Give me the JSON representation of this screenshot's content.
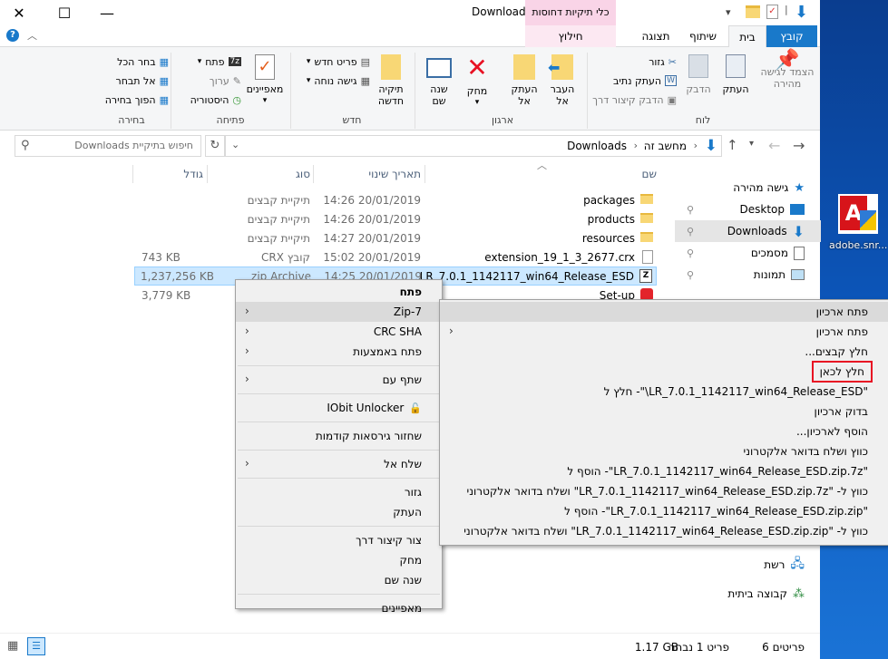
{
  "window": {
    "title": "Downloads",
    "context_tab_group": "כלי תיקיות דחוסות",
    "minimize": "—",
    "maximize": "☐",
    "close": "✕"
  },
  "ribbon_tabs": [
    "קובץ",
    "בית",
    "שיתוף",
    "תצוגה",
    "חילוץ"
  ],
  "ribbon": {
    "clipboard": {
      "pin": "הצמד לגישה\nמהירה",
      "copy": "העתק",
      "paste": "הדבק",
      "cut": "גזור",
      "copy_path": "העתק נתיב",
      "paste_shortcut": "הדבק קיצור דרך",
      "label": "לוח"
    },
    "organize": {
      "move_to": "העבר\nאל",
      "copy_to": "העתק\nאל",
      "delete": "מחק",
      "rename": "שנה\nשם",
      "label": "ארגון"
    },
    "new": {
      "new_folder": "תיקיה\nחדשה",
      "new_item": "פריט חדש",
      "easy_access": "גישה נוחה",
      "label": "חדש"
    },
    "open": {
      "properties": "מאפיינים",
      "open": "פתח",
      "edit": "ערוך",
      "history": "היסטוריה",
      "label": "פתיחה"
    },
    "select": {
      "select_all": "בחר הכל",
      "select_none": "אל תבחר",
      "invert": "הפוך בחירה",
      "label": "בחירה"
    }
  },
  "address": {
    "crumbs": [
      "מחשב זה",
      "Downloads"
    ],
    "search_placeholder": "חיפוש בתיקיית Downloads"
  },
  "columns": {
    "name": "שם",
    "date": "תאריך שינוי",
    "type": "סוג",
    "size": "גודל"
  },
  "files": [
    {
      "name": "packages",
      "date": "20/01/2019 14:26",
      "type": "תיקיית קבצים",
      "size": ""
    },
    {
      "name": "products",
      "date": "20/01/2019 14:26",
      "type": "תיקיית קבצים",
      "size": ""
    },
    {
      "name": "resources",
      "date": "20/01/2019 14:27",
      "type": "תיקיית קבצים",
      "size": ""
    },
    {
      "name": "extension_19_1_3_2677.crx",
      "date": "20/01/2019 15:02",
      "type": "קובץ CRX",
      "size": "743 KB"
    },
    {
      "name": "LR_7.0.1_1142117_win64_Release_ESD",
      "date": "20/01/2019 14:25",
      "type": "zip Archive",
      "size": "1,237,256 KB"
    },
    {
      "name": "Set-up",
      "date": "",
      "type": "",
      "size": "3,779 KB"
    }
  ],
  "nav": {
    "quick_access": "גישה מהירה",
    "desktop": "Desktop",
    "downloads": "Downloads",
    "documents": "מסמכים",
    "pictures": "תמונות",
    "network": "רשת",
    "homegroup": "קבוצה ביתית"
  },
  "context_menu": {
    "open": "פתח",
    "zip7": "7-Zip",
    "crc": "CRC SHA",
    "open_with": "פתח באמצעות",
    "share_with": "שתף עם",
    "iobit": "IObit Unlocker",
    "restore": "שחזור גירסאות קודמות",
    "send_to": "שלח אל",
    "cut": "גזור",
    "copy": "העתק",
    "create_shortcut": "צור קיצור דרך",
    "delete": "מחק",
    "rename": "שנה שם",
    "properties": "מאפיינים"
  },
  "zip_submenu": [
    "פתח ארכיון",
    "פתח ארכיון",
    "חלץ קבצים...",
    "חלץ לכאן",
    "\"LR_7.0.1_1142117_win64_Release_ESD\\\"- חלץ ל",
    "בדוק ארכיון",
    "הוסף לארכיון...",
    "כווץ ושלח בדואר אלקטרוני",
    "\"LR_7.0.1_1142117_win64_Release_ESD.zip.7z\"- הוסף ל",
    "כווץ ל- \"LR_7.0.1_1142117_win64_Release_ESD.zip.7z\" ושלח בדואר אלקטרוני",
    "\"LR_7.0.1_1142117_win64_Release_ESD.zip.zip\"- הוסף ל",
    "כווץ ל- \"LR_7.0.1_1142117_win64_Release_ESD.zip.zip\" ושלח בדואר אלקטרוני"
  ],
  "status": {
    "items": "6 פריטים",
    "selected": "פריט 1 נבחר",
    "size": "1.17 GB"
  },
  "desktop_icon": "adobe.snr...",
  "colors": {
    "accent": "#1979ca",
    "highlight": "#cce8ff",
    "context_tab": "#f9d4e7",
    "red_box": "#e81123"
  }
}
